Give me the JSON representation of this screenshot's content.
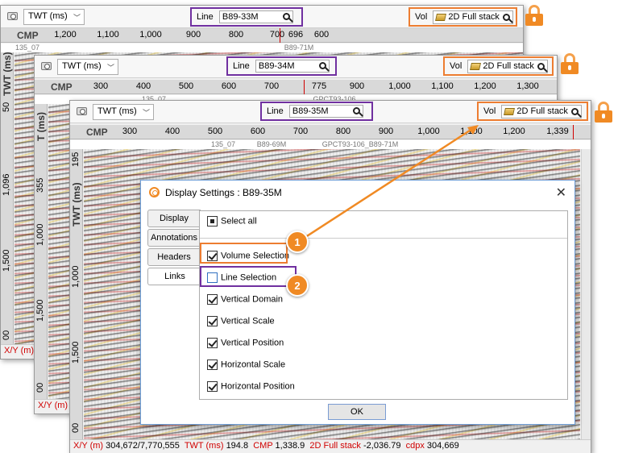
{
  "windows": [
    {
      "domain_select": "TWT (ms)",
      "line_label": "Line",
      "line_value": "B89-33M",
      "vol_label": "Vol",
      "vol_value": "2D Full stack",
      "cmp_label": "CMP",
      "cmp_ticks": [
        "1,200",
        "1,100",
        "1,000",
        "900",
        "800",
        "700",
        "696",
        "600"
      ],
      "line_labels": [
        "135_07",
        "B89-71M"
      ],
      "vaxis_title": "TWT (ms)",
      "vaxis_ticks": [
        "50",
        "1,096",
        "1,500",
        "00"
      ],
      "status_left": "X/Y (m)"
    },
    {
      "domain_select": "TWT (ms)",
      "line_label": "Line",
      "line_value": "B89-34M",
      "vol_label": "Vol",
      "vol_value": "2D Full stack",
      "cmp_label": "CMP",
      "cmp_ticks": [
        "300",
        "400",
        "500",
        "600",
        "700",
        "775",
        "900",
        "1,000",
        "1,100",
        "1,200",
        "1,300"
      ],
      "line_labels": [
        "135_07",
        "GPCT93-106"
      ],
      "vaxis_title": "T (ms)",
      "vaxis_ticks": [
        "355",
        "1,000",
        "1,500",
        "00"
      ],
      "status_left": "X/Y (m)"
    },
    {
      "domain_select": "TWT (ms)",
      "line_label": "Line",
      "line_value": "B89-35M",
      "vol_label": "Vol",
      "vol_value": "2D Full stack",
      "cmp_label": "CMP",
      "cmp_ticks": [
        "300",
        "400",
        "500",
        "600",
        "700",
        "800",
        "900",
        "1,000",
        "1,100",
        "1,200",
        "1,339"
      ],
      "line_labels": [
        "135_07",
        "B89-69M",
        "GPCT93-106_B89-71M"
      ],
      "vaxis_title": "TWT (ms)",
      "vaxis_ticks": [
        "195",
        "1,000",
        "1,500",
        "00"
      ],
      "status": {
        "xy_label": "X/Y (m)",
        "xy_value": "304,672/7,770,555",
        "twt_label": "TWT (ms)",
        "twt_value": "194.8",
        "cmp_label": "CMP",
        "cmp_value": "1,338.9",
        "vol_label": "2D Full stack",
        "vol_value": "-2,036.79",
        "cdpx_label": "cdpx",
        "cdpx_value": "304,669"
      }
    }
  ],
  "dialog": {
    "title": "Display Settings : B89-35M",
    "close_glyph": "✕",
    "tabs": [
      "Display",
      "Annotations",
      "Headers",
      "Links"
    ],
    "active_tab": "Links",
    "select_all": "Select all",
    "options": [
      {
        "label": "Volume Selection",
        "checked": true
      },
      {
        "label": "Line Selection",
        "checked": false
      },
      {
        "label": "Vertical Domain",
        "checked": true
      },
      {
        "label": "Vertical Scale",
        "checked": true
      },
      {
        "label": "Vertical Position",
        "checked": true
      },
      {
        "label": "Horizontal Scale",
        "checked": true
      },
      {
        "label": "Horizontal Position",
        "checked": true
      }
    ],
    "ok_label": "OK"
  },
  "callouts": [
    "1",
    "2"
  ],
  "colors": {
    "line_highlight": "#7030a0",
    "vol_highlight": "#ed7d31",
    "lock": "#f08a24",
    "status_red": "#d00000"
  },
  "icons": [
    "camera-icon",
    "chevron-down-icon",
    "search-icon",
    "folder-icon",
    "lock-icon",
    "display-settings-icon",
    "close-icon"
  ]
}
